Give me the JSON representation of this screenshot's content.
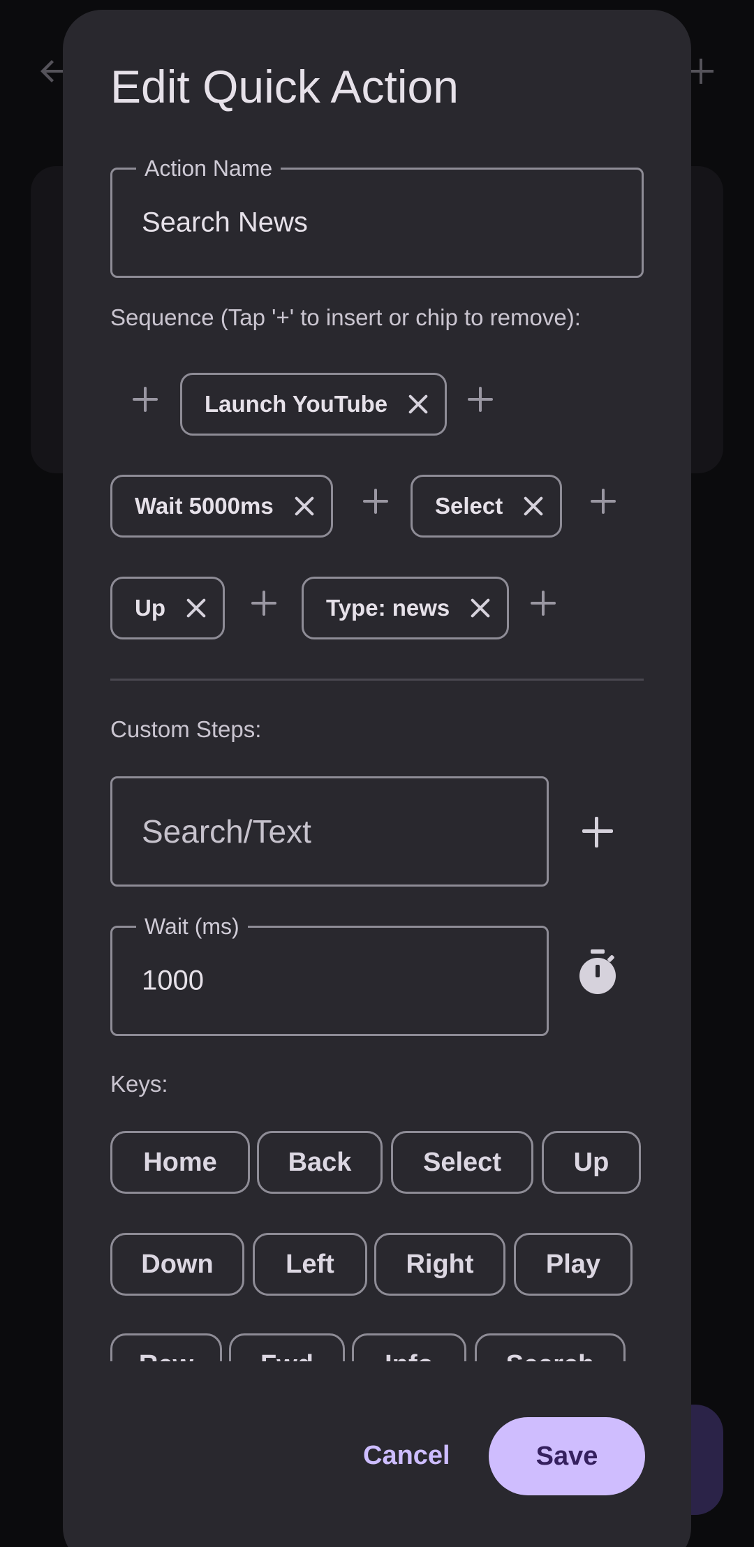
{
  "background": {
    "back_icon": "arrow-left-icon",
    "add_icon": "plus-icon"
  },
  "dialog": {
    "title": "Edit Quick Action",
    "action_name": {
      "label": "Action Name",
      "value": "Search News"
    },
    "sequence_label": "Sequence (Tap '+' to insert or chip to remove):",
    "sequence": [
      "Launch YouTube",
      "Wait 5000ms",
      "Select",
      "Up",
      "Type: news"
    ],
    "custom_steps_label": "Custom Steps:",
    "search_field": {
      "placeholder": "Search/Text"
    },
    "wait_field": {
      "label": "Wait (ms)",
      "value": "1000"
    },
    "keys_label": "Keys:",
    "keys_row1": [
      "Home",
      "Back",
      "Select",
      "Up"
    ],
    "keys_row2": [
      "Down",
      "Left",
      "Right",
      "Play"
    ],
    "keys_row3": [
      "Rew",
      "Fwd",
      "Info",
      "Search"
    ],
    "cancel_label": "Cancel",
    "save_label": "Save"
  },
  "colors": {
    "accent": "#cfbdfe",
    "surface": "#29282e",
    "outline": "#8e8c96"
  }
}
